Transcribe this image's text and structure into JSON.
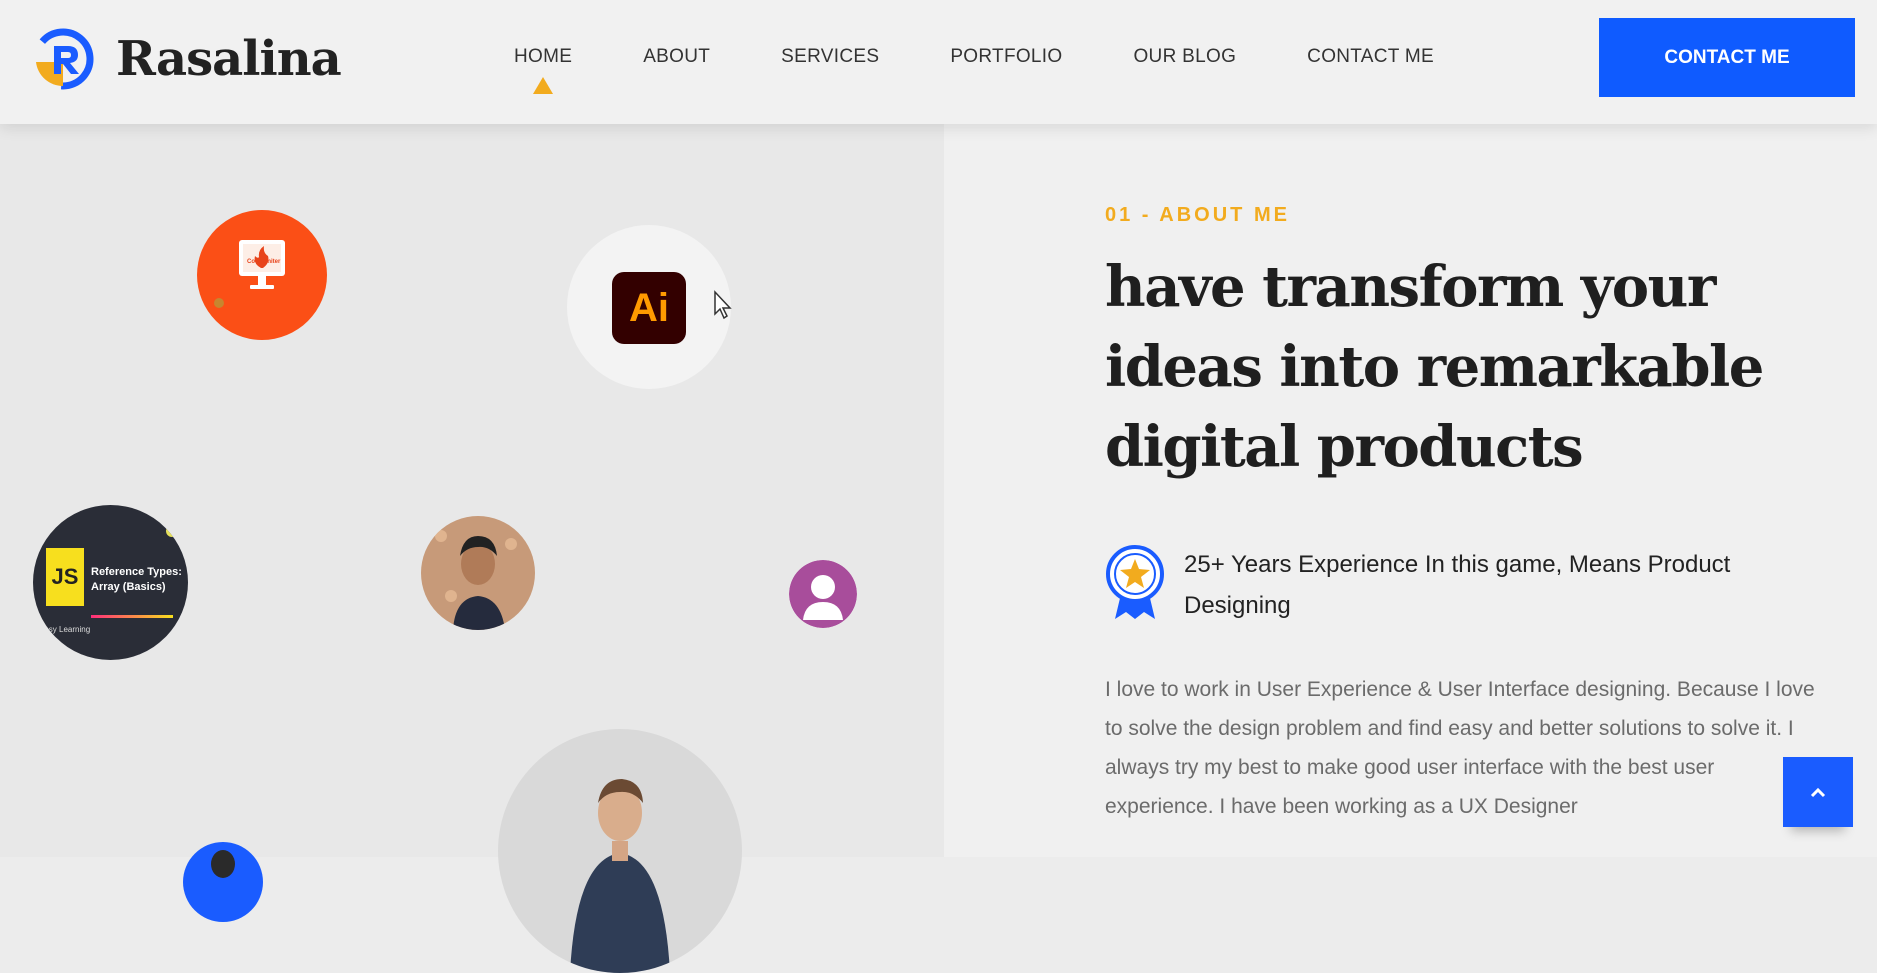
{
  "brand": {
    "name": "Rasalina",
    "logo_letter": "R",
    "accent": "#f2ab1e",
    "primary": "#0f5bff"
  },
  "nav": {
    "items": [
      {
        "label": "HOME",
        "active": true
      },
      {
        "label": "ABOUT"
      },
      {
        "label": "SERVICES"
      },
      {
        "label": "PORTFOLIO"
      },
      {
        "label": "OUR BLOG"
      },
      {
        "label": "CONTACT ME"
      }
    ],
    "cta_label": "CONTACT ME"
  },
  "bubbles": {
    "codeigniter": {
      "icon": "codeigniter-icon",
      "caption": "CodeIgniter"
    },
    "illustrator": {
      "icon": "illustrator-icon",
      "label": "Ai"
    },
    "js_tutorial": {
      "badge": "JS",
      "title_line1": "Reference Types:",
      "title_line2": "Array (Basics)",
      "brand": "Easy Learning"
    },
    "person": {
      "icon": "portrait-avatar"
    },
    "default_avatar": {
      "icon": "user-icon"
    },
    "featured": {
      "icon": "portrait-avatar"
    }
  },
  "about": {
    "eyebrow": "01 - ABOUT ME",
    "heading": "have transform your ideas into remarkable digital products",
    "experience": "25+ Years Experience In this game, Means Product Designing",
    "experience_icon": "award-icon",
    "description": "I love to work in User Experience & User Interface designing. Because I love to solve the design problem and find easy and better solutions to solve it. I always try my best to make good user interface with the best user experience. I have been working as a UX Designer"
  },
  "scroll_top_icon": "chevron-up-icon"
}
